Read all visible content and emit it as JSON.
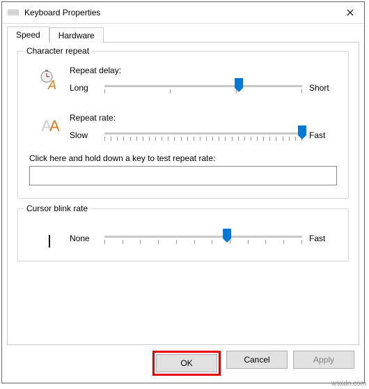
{
  "window": {
    "title": "Keyboard Properties"
  },
  "tabs": {
    "speed": "Speed",
    "hardware": "Hardware"
  },
  "group_repeat": {
    "title": "Character repeat",
    "delay_label": "Repeat delay:",
    "delay_min": "Long",
    "delay_max": "Short",
    "delay_value_pct": 68,
    "rate_label": "Repeat rate:",
    "rate_min": "Slow",
    "rate_max": "Fast",
    "rate_value_pct": 100,
    "test_label": "Click here and hold down a key to test repeat rate:",
    "test_value": ""
  },
  "group_blink": {
    "title": "Cursor blink rate",
    "min": "None",
    "max": "Fast",
    "value_pct": 62
  },
  "buttons": {
    "ok": "OK",
    "cancel": "Cancel",
    "apply": "Apply"
  },
  "watermark": "wsxdn.com"
}
